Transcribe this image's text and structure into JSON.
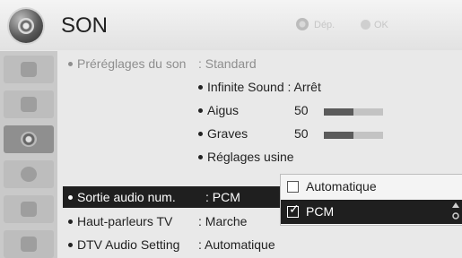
{
  "header": {
    "title": "SON",
    "hint_move": "Dép.",
    "hint_ok": "OK",
    "move_icon": "nav-arrows-icon",
    "ok_icon": "ok-button-icon"
  },
  "sidebar": {
    "items": [
      {
        "icon": "picture-icon",
        "active": false
      },
      {
        "icon": "screen-icon",
        "active": false
      },
      {
        "icon": "sound-icon",
        "active": true
      },
      {
        "icon": "clock-icon",
        "active": false
      },
      {
        "icon": "lock-icon",
        "active": false
      },
      {
        "icon": "option-icon",
        "active": false
      }
    ]
  },
  "menu": {
    "presets": {
      "label": "Préréglages du son",
      "value": ": Standard"
    },
    "infinite_sound": {
      "label": "Infinite Sound",
      "value": ": Arrêt"
    },
    "aigus": {
      "label": "Aigus",
      "value": "50",
      "level": 0.5
    },
    "graves": {
      "label": "Graves",
      "value": "50",
      "level": 0.5
    },
    "reglages_usine": {
      "label": "Réglages usine"
    },
    "sortie_audio": {
      "label": "Sortie audio num.",
      "value": ": PCM"
    },
    "haut_parleurs": {
      "label": "Haut-parleurs TV",
      "value": ": Marche"
    },
    "dtv_audio": {
      "label": "DTV Audio Setting",
      "value": ": Automatique"
    }
  },
  "popup": {
    "options": [
      {
        "label": "Automatique",
        "checked": false
      },
      {
        "label": "PCM",
        "checked": true
      }
    ]
  },
  "colors": {
    "highlight": "#1f1f1f",
    "background": "#e9e9e9",
    "sidebar": "#c9c9c9"
  }
}
